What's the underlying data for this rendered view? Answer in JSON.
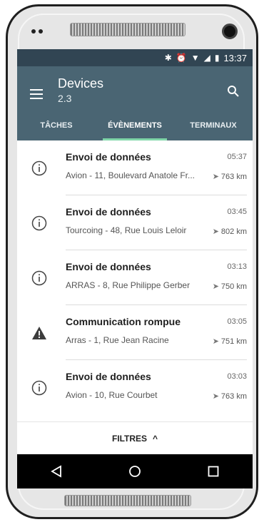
{
  "status": {
    "time": "13:37",
    "icons": [
      "bluetooth-icon",
      "alarm-icon",
      "wifi-icon",
      "signal-icon",
      "battery-icon"
    ]
  },
  "appbar": {
    "title": "Devices",
    "subtitle": "2.3"
  },
  "tabs": [
    {
      "label": "TÂCHES",
      "active": false
    },
    {
      "label": "ÉVÈNEMENTS",
      "active": true
    },
    {
      "label": "TERMINAUX",
      "active": false
    }
  ],
  "events": [
    {
      "icon": "info-icon",
      "title": "Envoi de données",
      "time": "05:37",
      "address": "Avion - 11, Boulevard Anatole Fr...",
      "distance": "763 km"
    },
    {
      "icon": "info-icon",
      "title": "Envoi de données",
      "time": "03:45",
      "address": "Tourcoing - 48, Rue Louis Leloir",
      "distance": "802 km"
    },
    {
      "icon": "info-icon",
      "title": "Envoi de données",
      "time": "03:13",
      "address": "ARRAS - 8, Rue Philippe Gerber",
      "distance": "750 km"
    },
    {
      "icon": "warning-icon",
      "title": "Communication rompue",
      "time": "03:05",
      "address": "Arras - 1, Rue Jean Racine",
      "distance": "751 km"
    },
    {
      "icon": "info-icon",
      "title": "Envoi de données",
      "time": "03:03",
      "address": "Avion - 10, Rue Courbet",
      "distance": "763 km"
    }
  ],
  "filters": {
    "label": "FILTRES"
  },
  "colors": {
    "statusbar": "#314553",
    "appbar": "#4a6573",
    "tab_indicator": "#7fd6a8"
  }
}
